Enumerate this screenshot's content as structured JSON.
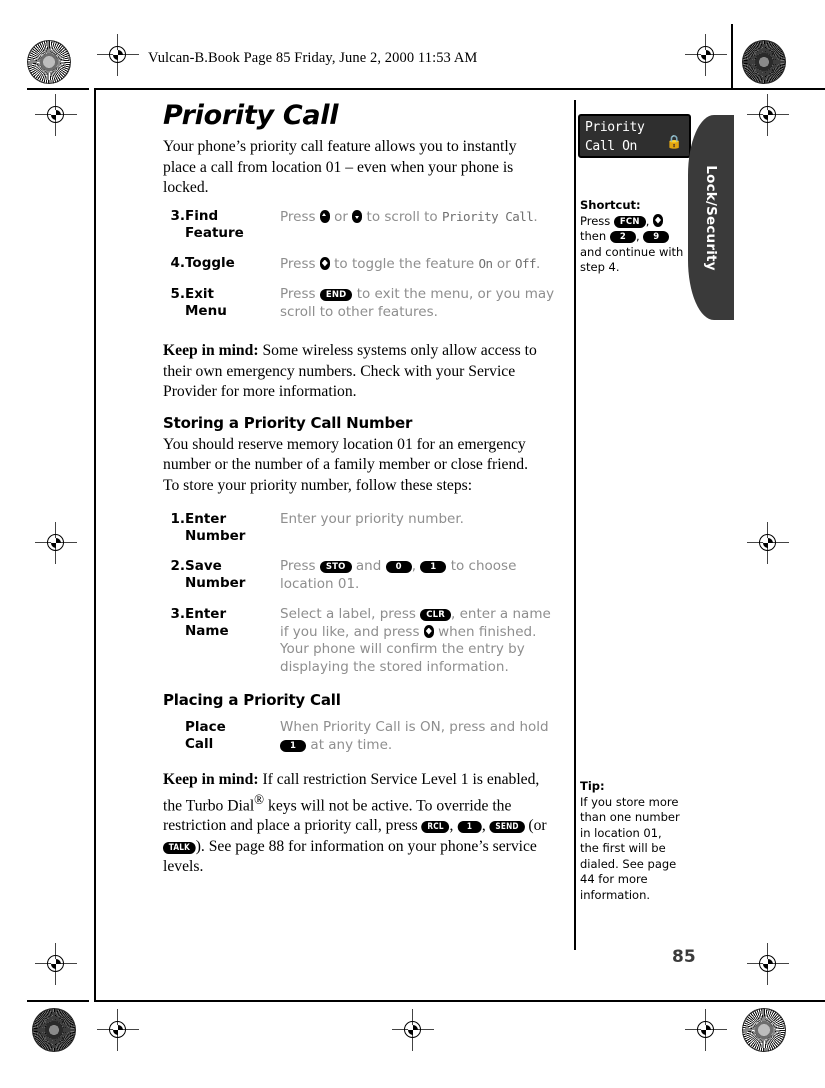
{
  "file_header": "Vulcan-B.Book  Page 85  Friday, June 2, 2000  11:53 AM",
  "page_number": "85",
  "title": "Priority Call",
  "intro": "Your phone’s priority call feature allows you to instantly place a call from location 01 –  even when your phone is locked.",
  "steps_feature": [
    {
      "num": "3.",
      "label": "Find Feature",
      "pre": "Press ",
      "mid": " or ",
      "post": " to scroll to ",
      "mono": "Priority Call",
      "tail": "."
    },
    {
      "num": "4.",
      "label": "Toggle",
      "pre": "Press ",
      "post": " to toggle the feature ",
      "mono": "On",
      "mid2": " or ",
      "mono2": "Off",
      "tail": "."
    },
    {
      "num": "5.",
      "label": "Exit",
      "label2": "Menu",
      "pre": "Press ",
      "key": "END",
      "post": " to exit the menu, or you may scroll to other features."
    }
  ],
  "keep_in_mind_1": {
    "lead": "Keep in mind:",
    "text": " Some wireless systems only allow access to their own emergency numbers. Check with your Service Provider for more information."
  },
  "storing": {
    "heading": "Storing a Priority Call Number",
    "text": "You should reserve memory location 01 for an emergency number or the number of a family member or close friend. To store your priority number, follow these steps:"
  },
  "steps_store": [
    {
      "num": "1.",
      "label": "Enter",
      "label2": "Number",
      "desc": "Enter your priority number."
    },
    {
      "num": "2.",
      "label": "Save",
      "label2": "Number",
      "pre": "Press ",
      "key1": "STO",
      "mid": " and ",
      "key2": "0",
      "mid2": ", ",
      "key3": "1",
      "post": " to choose location 01."
    },
    {
      "num": "3.",
      "label": "Enter",
      "label2": "Name",
      "pre": "Select a label, press ",
      "key1": "CLR",
      "mid": ", enter a name if you like, and press ",
      "post": " when finished. Your phone will confirm the entry by displaying the stored information."
    }
  ],
  "placing": {
    "heading": "Placing a Priority Call",
    "label": "Place",
    "label2": "Call",
    "pre": "When Priority Call is ON, press and hold ",
    "key1": "1",
    "post": " at any time."
  },
  "keep_in_mind_2": {
    "lead": "Keep in mind:",
    "t1": " If call restriction Service Level 1 is enabled, the Turbo Dial",
    "sup": "®",
    "t2": " keys will not be active. To override the restriction and place a priority call, press ",
    "key1": "RCL",
    "sep1": ", ",
    "key2": "1",
    "sep2": ", ",
    "key3": "SEND",
    "sep3": " (or ",
    "key4": "TALK",
    "t3": "). See page 88 for information on your phone’s service levels."
  },
  "lcd": {
    "line1": "Priority",
    "line2": "Call On",
    "lock_icon": "lock-icon"
  },
  "tab_label": "Lock/Security",
  "shortcut": {
    "title": "Shortcut:",
    "pre": "Press ",
    "key1": "FCN",
    "sep1": ", ",
    "mid": "then ",
    "key2": "2",
    "sep2": ", ",
    "key3": "9",
    "post": "and continue with step 4."
  },
  "tip": {
    "title": "Tip:",
    "text": "If you store more than one number in location 01, the first will be dialed. See page 44 for more information."
  },
  "colors": {
    "tab_bg": "#3a3a3a",
    "lcd_bg": "#2f2f2f",
    "step_text": "#8e8e8e"
  }
}
